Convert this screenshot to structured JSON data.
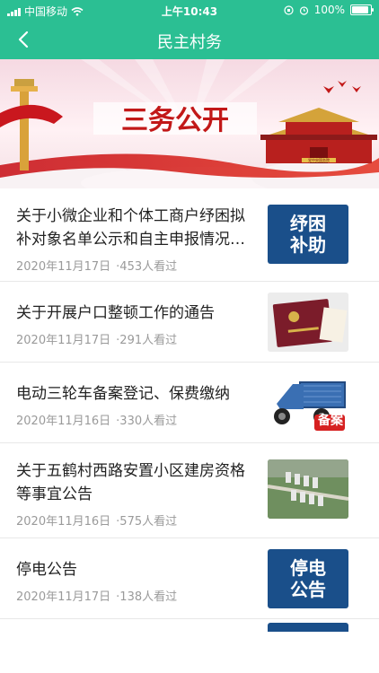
{
  "status_bar": {
    "carrier": "中国移动",
    "time": "上午10:43",
    "battery": "100%",
    "battery_level": 1.0
  },
  "nav": {
    "title": "民主村务",
    "back_icon": "chevron-left-icon"
  },
  "banner": {
    "title": "三务公开",
    "sub_badge": "党中央国务院"
  },
  "news": [
    {
      "title": "关于小微企业和个体工商户纾困拟补对象名单公示和自主申报情况…",
      "date": "2020年11月17日",
      "views": "·453人看过",
      "thumb_type": "badge",
      "thumb_line1": "纾困",
      "thumb_line2": "补助"
    },
    {
      "title": "关于开展户口整顿工作的通告",
      "date": "2020年11月17日",
      "views": "·291人看过",
      "thumb_type": "booklet"
    },
    {
      "title": "电动三轮车备案登记、保费缴纳",
      "date": "2020年11月16日",
      "views": "·330人看过",
      "thumb_type": "tricycle",
      "thumb_label": "备案"
    },
    {
      "title": "关于五鹤村西路安置小区建房资格等事宜公告",
      "date": "2020年11月16日",
      "views": "·575人看过",
      "thumb_type": "aerial"
    },
    {
      "title": "停电公告",
      "date": "2020年11月17日",
      "views": "·138人看过",
      "thumb_type": "badge",
      "thumb_line1": "停电",
      "thumb_line2": "公告"
    }
  ],
  "colors": {
    "accent": "#2bbf93",
    "badge_blue": "#1a4f8a",
    "meta_gray": "#9a9a9a"
  }
}
